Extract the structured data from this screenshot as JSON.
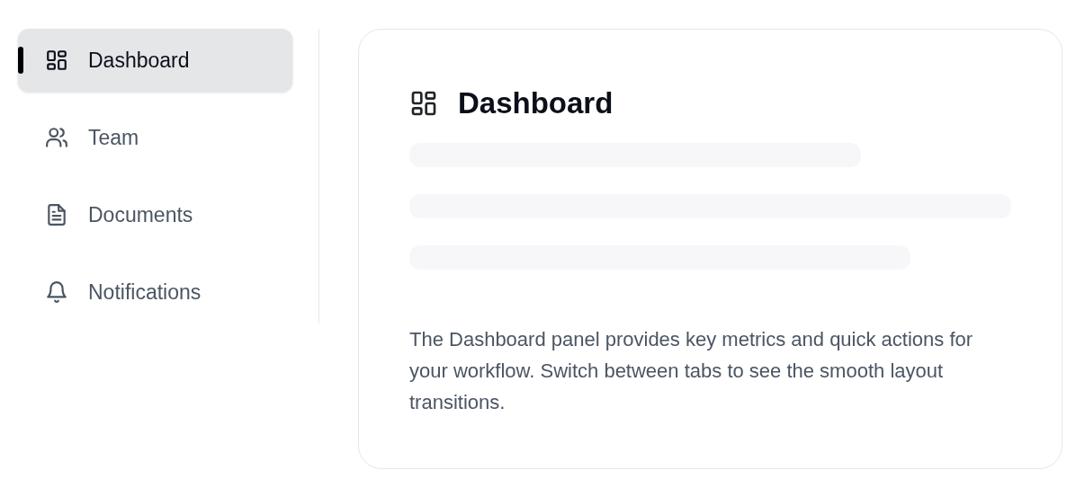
{
  "sidebar": {
    "items": [
      {
        "label": "Dashboard",
        "selected": true
      },
      {
        "label": "Team",
        "selected": false
      },
      {
        "label": "Documents",
        "selected": false
      },
      {
        "label": "Notifications",
        "selected": false
      }
    ]
  },
  "panel": {
    "title": "Dashboard",
    "description": "The Dashboard panel provides key metrics and quick actions for your workflow. Switch between tabs to see the smooth layout transitions."
  }
}
